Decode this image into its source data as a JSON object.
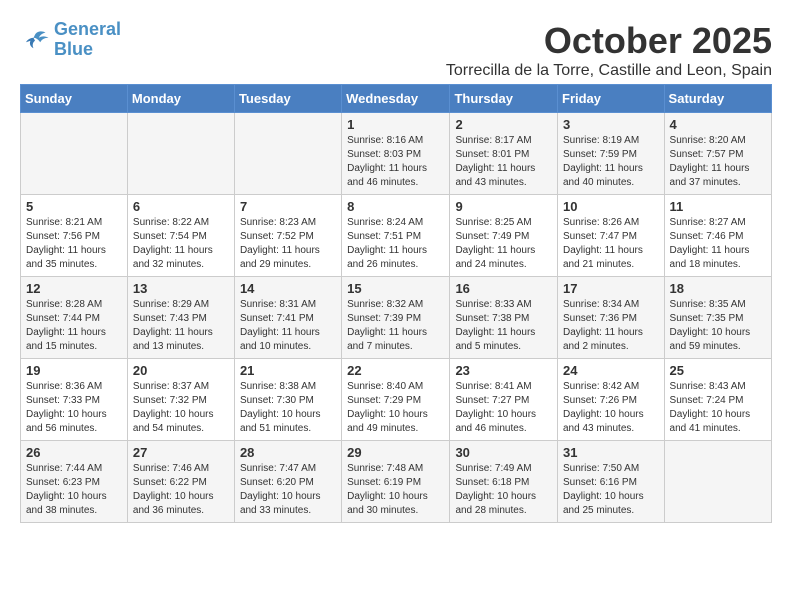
{
  "logo": {
    "line1": "General",
    "line2": "Blue"
  },
  "title": "October 2025",
  "subtitle": "Torrecilla de la Torre, Castille and Leon, Spain",
  "weekdays": [
    "Sunday",
    "Monday",
    "Tuesday",
    "Wednesday",
    "Thursday",
    "Friday",
    "Saturday"
  ],
  "weeks": [
    [
      {
        "day": "",
        "info": ""
      },
      {
        "day": "",
        "info": ""
      },
      {
        "day": "",
        "info": ""
      },
      {
        "day": "1",
        "info": "Sunrise: 8:16 AM\nSunset: 8:03 PM\nDaylight: 11 hours and 46 minutes."
      },
      {
        "day": "2",
        "info": "Sunrise: 8:17 AM\nSunset: 8:01 PM\nDaylight: 11 hours and 43 minutes."
      },
      {
        "day": "3",
        "info": "Sunrise: 8:19 AM\nSunset: 7:59 PM\nDaylight: 11 hours and 40 minutes."
      },
      {
        "day": "4",
        "info": "Sunrise: 8:20 AM\nSunset: 7:57 PM\nDaylight: 11 hours and 37 minutes."
      }
    ],
    [
      {
        "day": "5",
        "info": "Sunrise: 8:21 AM\nSunset: 7:56 PM\nDaylight: 11 hours and 35 minutes."
      },
      {
        "day": "6",
        "info": "Sunrise: 8:22 AM\nSunset: 7:54 PM\nDaylight: 11 hours and 32 minutes."
      },
      {
        "day": "7",
        "info": "Sunrise: 8:23 AM\nSunset: 7:52 PM\nDaylight: 11 hours and 29 minutes."
      },
      {
        "day": "8",
        "info": "Sunrise: 8:24 AM\nSunset: 7:51 PM\nDaylight: 11 hours and 26 minutes."
      },
      {
        "day": "9",
        "info": "Sunrise: 8:25 AM\nSunset: 7:49 PM\nDaylight: 11 hours and 24 minutes."
      },
      {
        "day": "10",
        "info": "Sunrise: 8:26 AM\nSunset: 7:47 PM\nDaylight: 11 hours and 21 minutes."
      },
      {
        "day": "11",
        "info": "Sunrise: 8:27 AM\nSunset: 7:46 PM\nDaylight: 11 hours and 18 minutes."
      }
    ],
    [
      {
        "day": "12",
        "info": "Sunrise: 8:28 AM\nSunset: 7:44 PM\nDaylight: 11 hours and 15 minutes."
      },
      {
        "day": "13",
        "info": "Sunrise: 8:29 AM\nSunset: 7:43 PM\nDaylight: 11 hours and 13 minutes."
      },
      {
        "day": "14",
        "info": "Sunrise: 8:31 AM\nSunset: 7:41 PM\nDaylight: 11 hours and 10 minutes."
      },
      {
        "day": "15",
        "info": "Sunrise: 8:32 AM\nSunset: 7:39 PM\nDaylight: 11 hours and 7 minutes."
      },
      {
        "day": "16",
        "info": "Sunrise: 8:33 AM\nSunset: 7:38 PM\nDaylight: 11 hours and 5 minutes."
      },
      {
        "day": "17",
        "info": "Sunrise: 8:34 AM\nSunset: 7:36 PM\nDaylight: 11 hours and 2 minutes."
      },
      {
        "day": "18",
        "info": "Sunrise: 8:35 AM\nSunset: 7:35 PM\nDaylight: 10 hours and 59 minutes."
      }
    ],
    [
      {
        "day": "19",
        "info": "Sunrise: 8:36 AM\nSunset: 7:33 PM\nDaylight: 10 hours and 56 minutes."
      },
      {
        "day": "20",
        "info": "Sunrise: 8:37 AM\nSunset: 7:32 PM\nDaylight: 10 hours and 54 minutes."
      },
      {
        "day": "21",
        "info": "Sunrise: 8:38 AM\nSunset: 7:30 PM\nDaylight: 10 hours and 51 minutes."
      },
      {
        "day": "22",
        "info": "Sunrise: 8:40 AM\nSunset: 7:29 PM\nDaylight: 10 hours and 49 minutes."
      },
      {
        "day": "23",
        "info": "Sunrise: 8:41 AM\nSunset: 7:27 PM\nDaylight: 10 hours and 46 minutes."
      },
      {
        "day": "24",
        "info": "Sunrise: 8:42 AM\nSunset: 7:26 PM\nDaylight: 10 hours and 43 minutes."
      },
      {
        "day": "25",
        "info": "Sunrise: 8:43 AM\nSunset: 7:24 PM\nDaylight: 10 hours and 41 minutes."
      }
    ],
    [
      {
        "day": "26",
        "info": "Sunrise: 7:44 AM\nSunset: 6:23 PM\nDaylight: 10 hours and 38 minutes."
      },
      {
        "day": "27",
        "info": "Sunrise: 7:46 AM\nSunset: 6:22 PM\nDaylight: 10 hours and 36 minutes."
      },
      {
        "day": "28",
        "info": "Sunrise: 7:47 AM\nSunset: 6:20 PM\nDaylight: 10 hours and 33 minutes."
      },
      {
        "day": "29",
        "info": "Sunrise: 7:48 AM\nSunset: 6:19 PM\nDaylight: 10 hours and 30 minutes."
      },
      {
        "day": "30",
        "info": "Sunrise: 7:49 AM\nSunset: 6:18 PM\nDaylight: 10 hours and 28 minutes."
      },
      {
        "day": "31",
        "info": "Sunrise: 7:50 AM\nSunset: 6:16 PM\nDaylight: 10 hours and 25 minutes."
      },
      {
        "day": "",
        "info": ""
      }
    ]
  ]
}
